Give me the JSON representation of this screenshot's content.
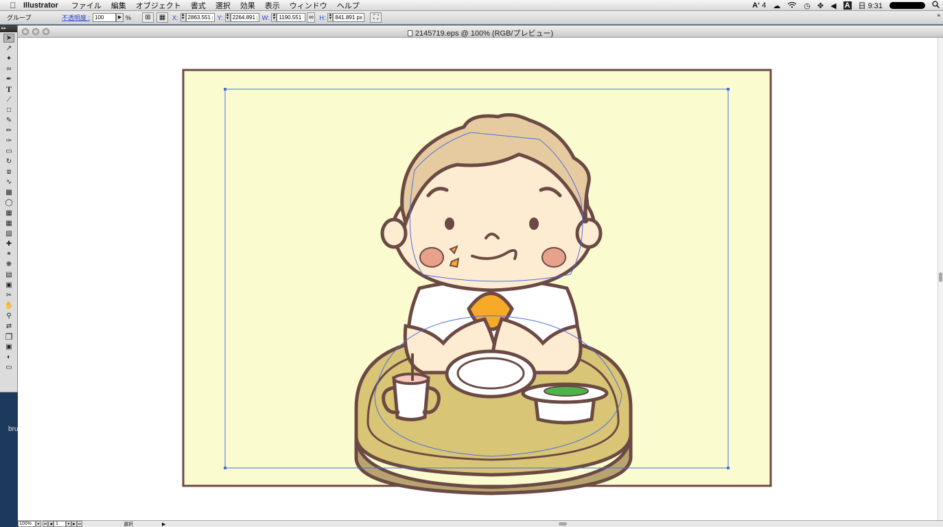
{
  "menubar": {
    "app_name": "Illustrator",
    "menus": [
      "ファイル",
      "編集",
      "オブジェクト",
      "書式",
      "選択",
      "効果",
      "表示",
      "ウィンドウ",
      "ヘルプ"
    ],
    "status": {
      "adobe_badge": "4",
      "clock": "日 9:31",
      "input_method": "A"
    }
  },
  "controlbar": {
    "selection_label": "グループ",
    "opacity_label": "不透明度 :",
    "opacity_value": "100",
    "percent_sign": "%",
    "x_label": "X:",
    "x_value": "2863.551 p",
    "y_label": "Y:",
    "y_value": "2264.891 p",
    "w_label": "W:",
    "w_value": "1190.551 p",
    "h_label": "H:",
    "h_value": "841.891 px"
  },
  "document": {
    "title": "2145719.eps @ 100% (RGB/プレビュー)"
  },
  "statusbar": {
    "zoom": "100%",
    "page": "1",
    "tool_status": "選択"
  },
  "desktop": {
    "partial_text": "bru"
  },
  "artwork": {
    "background_color": "#fafcd0",
    "outline_color": "#6b4a44",
    "skin_color": "#fdebd2",
    "hair_color": "#e7cba0",
    "tray_color": "#d8c575",
    "egg_color": "#f7a928",
    "cheek_color": "#e8a28b",
    "greens_color": "#4db34a",
    "selection_color": "#4a6ee0"
  },
  "tools": [
    "selection-tool",
    "direct-selection-tool",
    "magic-wand-tool",
    "lasso-tool",
    "pen-tool",
    "type-tool",
    "line-tool",
    "rectangle-tool",
    "paintbrush-tool",
    "pencil-tool",
    "blob-brush-tool",
    "eraser-tool",
    "rotate-tool",
    "scale-tool",
    "warp-tool",
    "free-transform-tool",
    "shape-builder-tool",
    "perspective-tool",
    "mesh-tool",
    "gradient-tool",
    "eyedropper-tool",
    "blend-tool",
    "symbol-sprayer-tool",
    "graph-tool",
    "artboard-tool",
    "slice-tool",
    "hand-tool",
    "zoom-tool",
    "swap-colors-tool",
    "fill-stroke-tool",
    "color-mode-tool",
    "draw-mode-tool",
    "screen-mode-tool"
  ]
}
